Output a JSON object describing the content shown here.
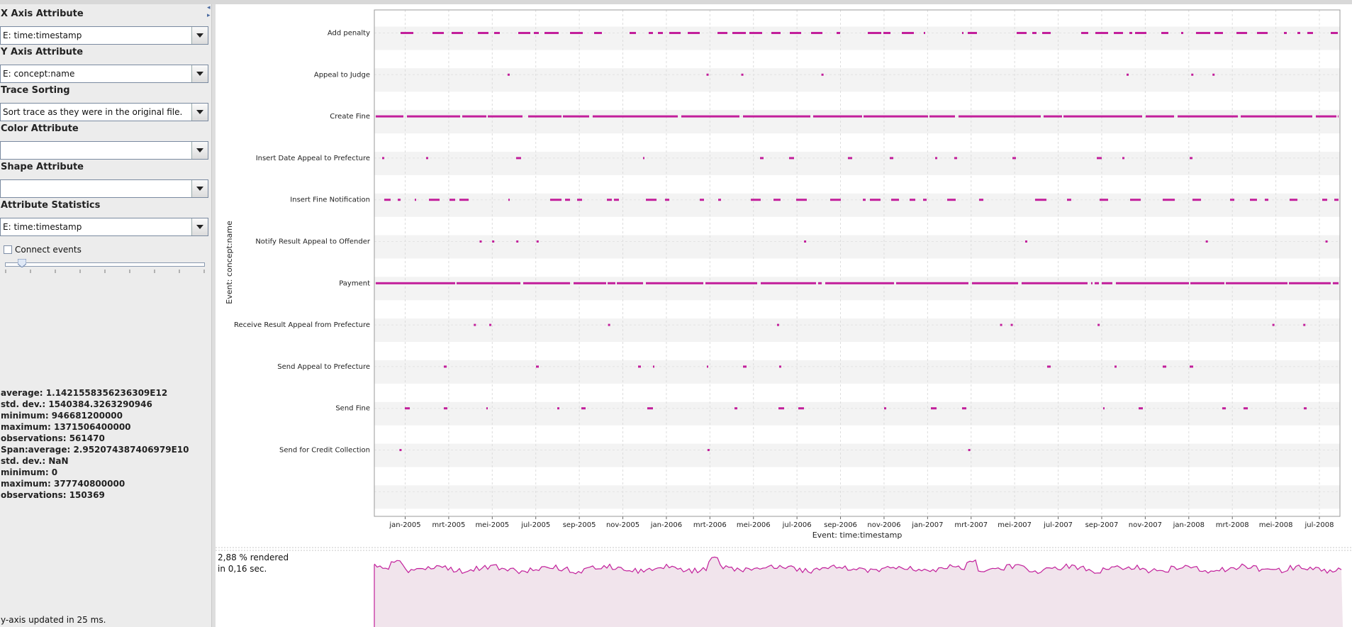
{
  "left_panel": {
    "x_axis": {
      "label": "X Axis Attribute",
      "value": "E: time:timestamp"
    },
    "y_axis": {
      "label": "Y Axis Attribute",
      "value": "E: concept:name"
    },
    "trace_sorting": {
      "label": "Trace Sorting",
      "value": "Sort trace as they were in the original file."
    },
    "color_attr": {
      "label": "Color Attribute",
      "value": ""
    },
    "shape_attr": {
      "label": "Shape Attribute",
      "value": ""
    },
    "attr_stats": {
      "label": "Attribute Statistics",
      "value": "E: time:timestamp"
    },
    "connect_events": {
      "label": "Connect events",
      "checked": false
    },
    "statistics": [
      "average: 1.1421558356236309E12",
      "std. dev.: 1540384.3263290946",
      "minimum: 946681200000",
      "maximum: 1371506400000",
      "observations: 561470",
      "Span:average: 2.952074387406979E10",
      "std. dev.: NaN",
      "minimum: 0",
      "maximum: 377740800000",
      "observations: 150369"
    ],
    "status": "y-axis updated in 25 ms."
  },
  "render_info": {
    "line1": "2,88 % rendered",
    "line2": "in 0,16 sec."
  },
  "colors": {
    "marker": "#c21f9b",
    "band": "#f3f3f3",
    "overview_fill": "#f1e4ec"
  },
  "chart_data": {
    "type": "scatter",
    "xlabel": "Event: time:timestamp",
    "ylabel": "Event: concept:name",
    "x_ticks": [
      "jan-2005",
      "mrt-2005",
      "mei-2005",
      "jul-2005",
      "sep-2005",
      "nov-2005",
      "jan-2006",
      "mrt-2006",
      "mei-2006",
      "jul-2006",
      "sep-2006",
      "nov-2006",
      "jan-2007",
      "mrt-2007",
      "mei-2007",
      "jul-2007",
      "sep-2007",
      "nov-2007",
      "jan-2008",
      "mrt-2008",
      "mei-2008",
      "jul-2008"
    ],
    "xlim": [
      "2004-11-15",
      "2008-08-10"
    ],
    "categories": [
      "Add penalty",
      "Appeal to Judge",
      "Create Fine",
      "Insert Date Appeal to Prefecture",
      "Insert Fine Notification",
      "Notify Result Appeal to Offender",
      "Payment",
      "Receive Result Appeal from Prefecture",
      "Send Appeal to Prefecture",
      "Send Fine",
      "Send for Credit Collection"
    ],
    "density": [
      0.55,
      0.05,
      0.95,
      0.12,
      0.45,
      0.03,
      0.92,
      0.03,
      0.08,
      0.18,
      0.01
    ],
    "sparse_events": {
      "Appeal to Judge": [
        0.138,
        0.344,
        0.38,
        0.463,
        0.779,
        0.846,
        0.868
      ],
      "Notify Result Appeal to Offender": [
        0.109,
        0.122,
        0.147,
        0.168,
        0.445,
        0.674,
        0.861,
        0.985
      ],
      "Receive Result Appeal from Prefecture": [
        0.103,
        0.119,
        0.242,
        0.417,
        0.648,
        0.659,
        0.749,
        0.93,
        0.962
      ],
      "Send for Credit Collection": [
        0.026,
        0.345,
        0.615
      ]
    }
  }
}
